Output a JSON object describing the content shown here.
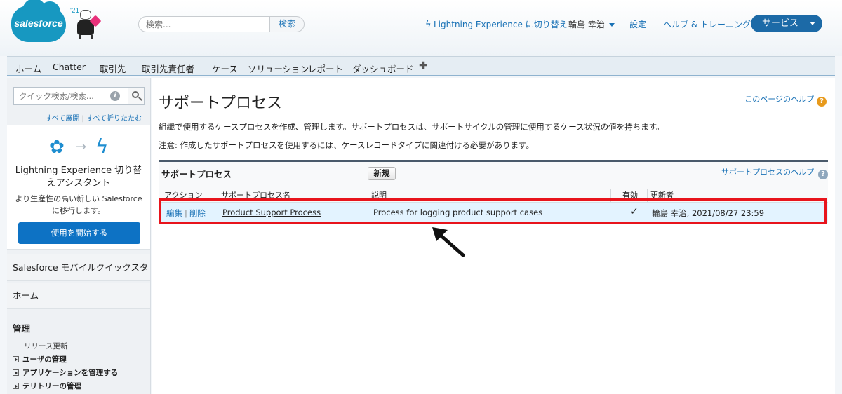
{
  "header": {
    "logo_text": "salesforce",
    "release_label": "'21",
    "search_placeholder": "検索...",
    "search_button": "検索",
    "lightning_switch": "Lightning Experience に切り替え",
    "user_name": "輪島 幸治",
    "setup": "設定",
    "help_training": "ヘルプ & トレーニング",
    "app_switcher": "サービス"
  },
  "tabs": [
    "ホーム",
    "Chatter",
    "取引先",
    "取引先責任者",
    "ケース",
    "ソリューション",
    "レポート",
    "ダッシュボード"
  ],
  "tab_plus": "✚",
  "sidebar": {
    "quick_search_placeholder": "クイック検索/検索...",
    "info_icon": "i",
    "expand_all": "すべて展開",
    "collapse_all": "すべて折りたたむ",
    "expand_sep": "|",
    "lightning_title": "Lightning Experience 切り替えアシスタント",
    "lightning_desc": "より生産性の高い新しい Salesforce に移行します。",
    "lightning_button": "使用を開始する",
    "items": [
      "Salesforce モバイルクイックスタート",
      "ホーム"
    ],
    "admin_heading": "管理",
    "release_updates": "リリース更新",
    "tree_items": [
      "ユーザの管理",
      "アプリケーションを管理する",
      "テリトリーの管理"
    ]
  },
  "main": {
    "title": "サポートプロセス",
    "page_help": "このページのヘルプ",
    "description": "組織で使用するケースプロセスを作成、管理します。サポートプロセスは、サポートサイクルの管理に使用するケース状況の値を持ちます。",
    "note_prefix": "注意: 作成したサポートプロセスを使用するには、",
    "note_link": "ケースレコードタイプ",
    "note_suffix": "に関連付ける必要があります。",
    "panel_title": "サポートプロセス",
    "new_button": "新規",
    "panel_help": "サポートプロセスのヘルプ",
    "columns": [
      "アクション",
      "サポートプロセス名",
      "説明",
      "有効",
      "更新者"
    ],
    "row": {
      "edit": "編集",
      "delete": "削除",
      "sep": "|",
      "name": "Product Support Process",
      "description": "Process for logging product support cases",
      "active": "✓",
      "modified_by": "輪島 幸治",
      "modified_date": ", 2021/08/27 23:59"
    }
  },
  "colors": {
    "brand_blue": "#1798c1",
    "link_blue": "#1a72b6",
    "highlight_red": "#e8141c",
    "row_highlight": "#e3f3ff"
  }
}
